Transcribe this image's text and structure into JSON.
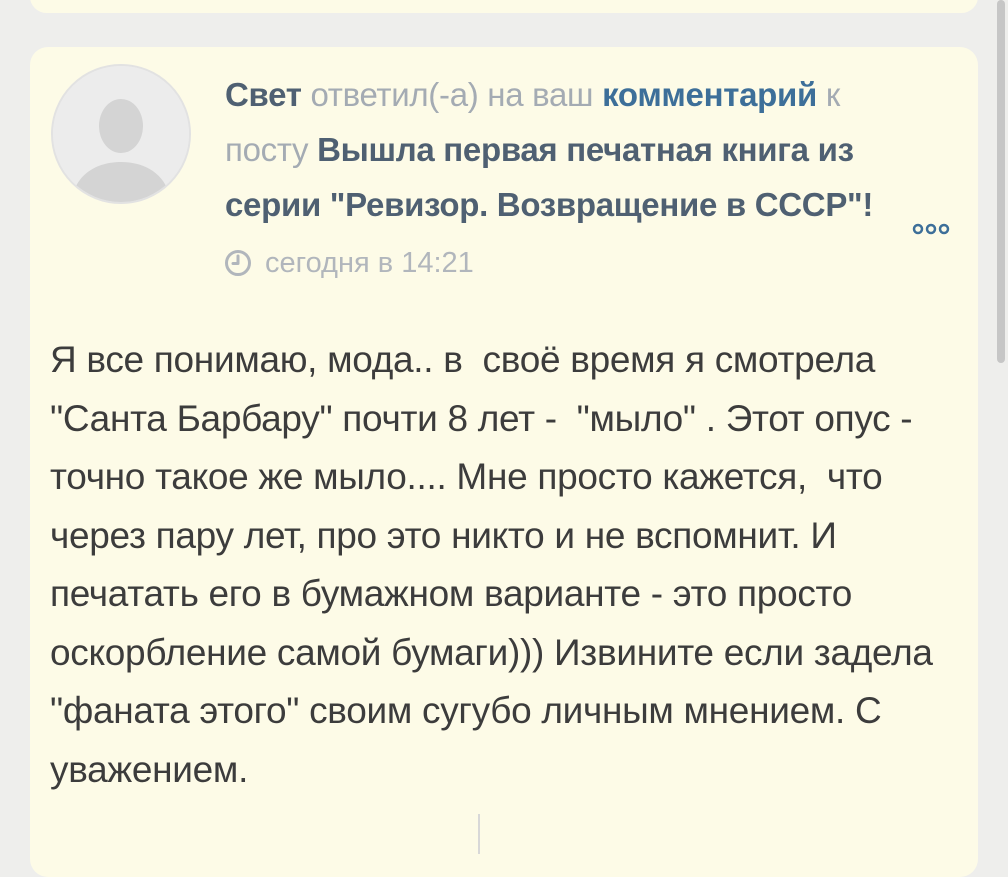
{
  "notification": {
    "user_name": "Свет",
    "action_text": " ответил(-а) на ваш ",
    "comment_link": "комментарий",
    "to_text": " к посту ",
    "post_title": "Вышла первая печатная книга из серии \"Ревизор. Возвращение в СССР\"!",
    "timestamp": "сегодня в 14:21",
    "more_icon": "more-dots-icon",
    "avatar_icon": "default-user-avatar-icon",
    "clock_icon": "clock-icon"
  },
  "comment": {
    "text": "Я все понимаю, мода.. в  своё время я смотрела \"Санта Барбару\" почти 8 лет -  \"мыло\" . Этот опус - точно такое же мыло.... Мне просто кажется,  что через пару лет, про это никто и не вспомнит. И печатать его в бумажном варианте - это просто оскорбление самой бумаги))) Извините если задела \"фаната этого\" своим сугубо личным мнением. С уважением."
  },
  "colors": {
    "card_background": "#fdfbe7",
    "page_background": "#eeeeec",
    "user_name": "#4f6072",
    "link": "#3d6f99",
    "muted_text": "#a4abb3",
    "body_text": "#3c3c3c"
  }
}
